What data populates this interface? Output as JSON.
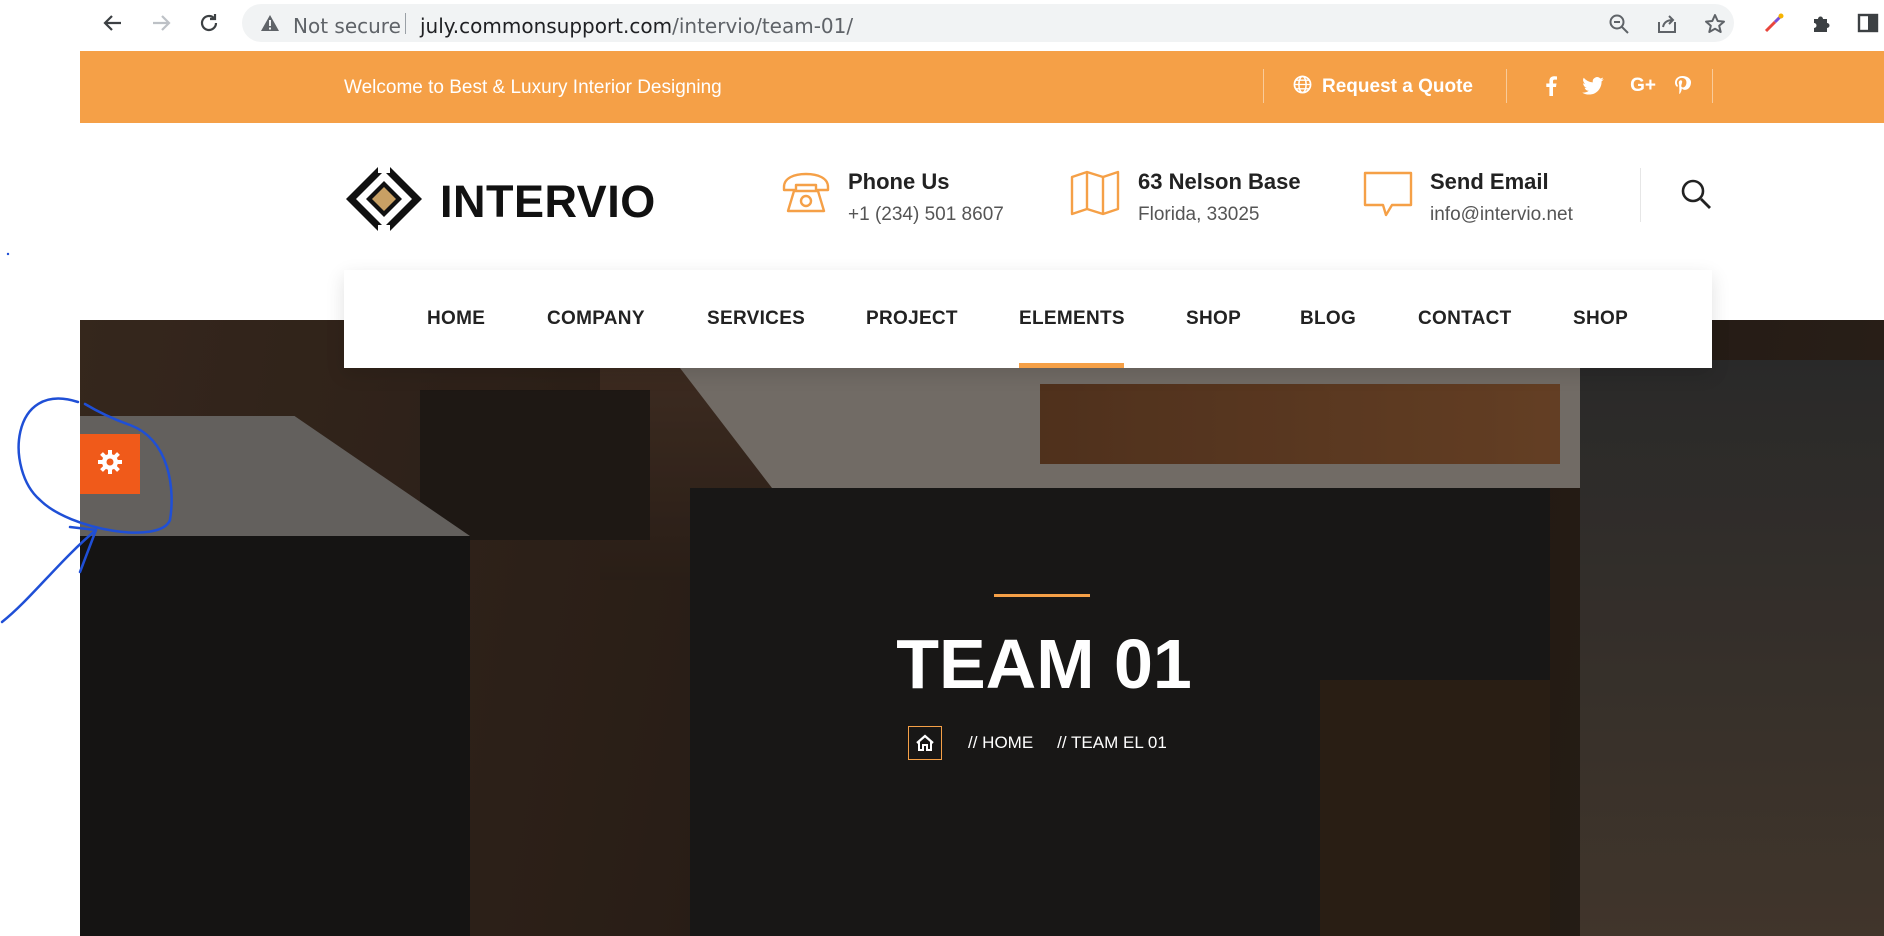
{
  "browser": {
    "security_label": "Not secure",
    "url_host": "july.commonsupport.com",
    "url_path": "/intervio/team-01/"
  },
  "topbar": {
    "welcome": "Welcome to Best & Luxury Interior Designing",
    "quote_label": "Request a Quote",
    "social": [
      "facebook-icon",
      "twitter-icon",
      "google-plus-icon",
      "pinterest-icon"
    ],
    "google_plus_glyph": "G+"
  },
  "logo": {
    "text": "INTERVIO"
  },
  "header": {
    "phone": {
      "title": "Phone Us",
      "value": "+1 (234) 501 8607"
    },
    "address": {
      "title": "63 Nelson Base",
      "value": "Florida, 33025"
    },
    "email": {
      "title": "Send Email",
      "value": "info@intervio.net"
    }
  },
  "nav": {
    "items": [
      "HOME",
      "COMPANY",
      "SERVICES",
      "PROJECT",
      "ELEMENTS",
      "SHOP",
      "BLOG",
      "CONTACT",
      "SHOP"
    ],
    "active": "ELEMENTS"
  },
  "hero": {
    "title": "TEAM 01",
    "breadcrumb": [
      "// HOME",
      "// TEAM EL 01"
    ]
  },
  "colors": {
    "accent": "#f5a047",
    "gear": "#f05a1a",
    "annotation": "#1f4fd6"
  }
}
